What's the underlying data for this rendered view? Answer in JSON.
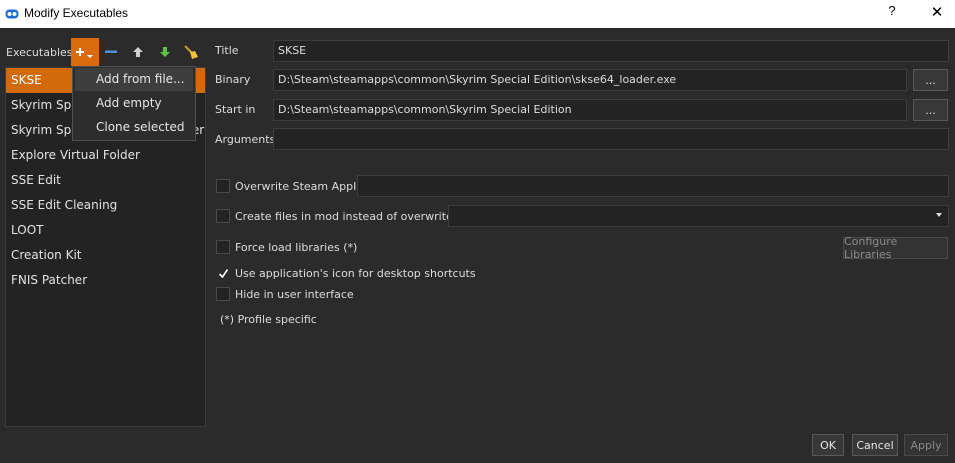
{
  "window": {
    "title": "Modify Executables",
    "help_glyph": "?",
    "close_glyph": "✕",
    "icon": "window-app-icon"
  },
  "executables": {
    "label": "Executables",
    "toolbar": {
      "add_icon": "plus-dropdown-icon",
      "remove_icon": "minus-icon",
      "move_up_icon": "arrow-up-icon",
      "move_down_icon": "arrow-down-icon",
      "clean_icon": "broom-icon",
      "accent": "#d96b0d"
    },
    "items": [
      {
        "label": "SKSE"
      },
      {
        "label": "Skyrim Special Edition"
      },
      {
        "label": "Skyrim Special Edition Launcher"
      },
      {
        "label": "Explore Virtual Folder"
      },
      {
        "label": "SSE Edit"
      },
      {
        "label": "SSE Edit Cleaning"
      },
      {
        "label": "LOOT"
      },
      {
        "label": "Creation Kit"
      },
      {
        "label": "FNIS Patcher"
      }
    ],
    "selected": "SKSE"
  },
  "add_menu": {
    "items": [
      {
        "label": "Add from file..."
      },
      {
        "label": "Add empty"
      },
      {
        "label": "Clone selected"
      }
    ]
  },
  "form": {
    "title_label": "Title",
    "title_value": "SKSE",
    "binary_label": "Binary",
    "binary_value": "D:\\Steam\\steamapps\\common\\Skyrim Special Edition\\skse64_loader.exe",
    "binary_browse": "...",
    "startin_label": "Start in",
    "startin_value": "D:\\Steam\\steamapps\\common\\Skyrim Special Edition",
    "startin_browse": "...",
    "arguments_label": "Arguments",
    "arguments_value": "",
    "overwrite_appid_label": "Overwrite Steam AppID",
    "overwrite_appid_checked": false,
    "appid_value": "",
    "create_files_label": "Create files in mod instead of overwrite (*)",
    "create_files_checked": false,
    "create_files_value": "",
    "force_load_label": "Force load libraries (*)",
    "force_load_checked": false,
    "configure_libraries": "Configure Libraries",
    "use_icon_label": "Use application's icon for desktop shortcuts",
    "use_icon_checked": true,
    "hide_label": "Hide in user interface",
    "hide_checked": false,
    "profile_note": "(*) Profile specific"
  },
  "buttons": {
    "ok": "OK",
    "cancel": "Cancel",
    "apply": "Apply"
  }
}
